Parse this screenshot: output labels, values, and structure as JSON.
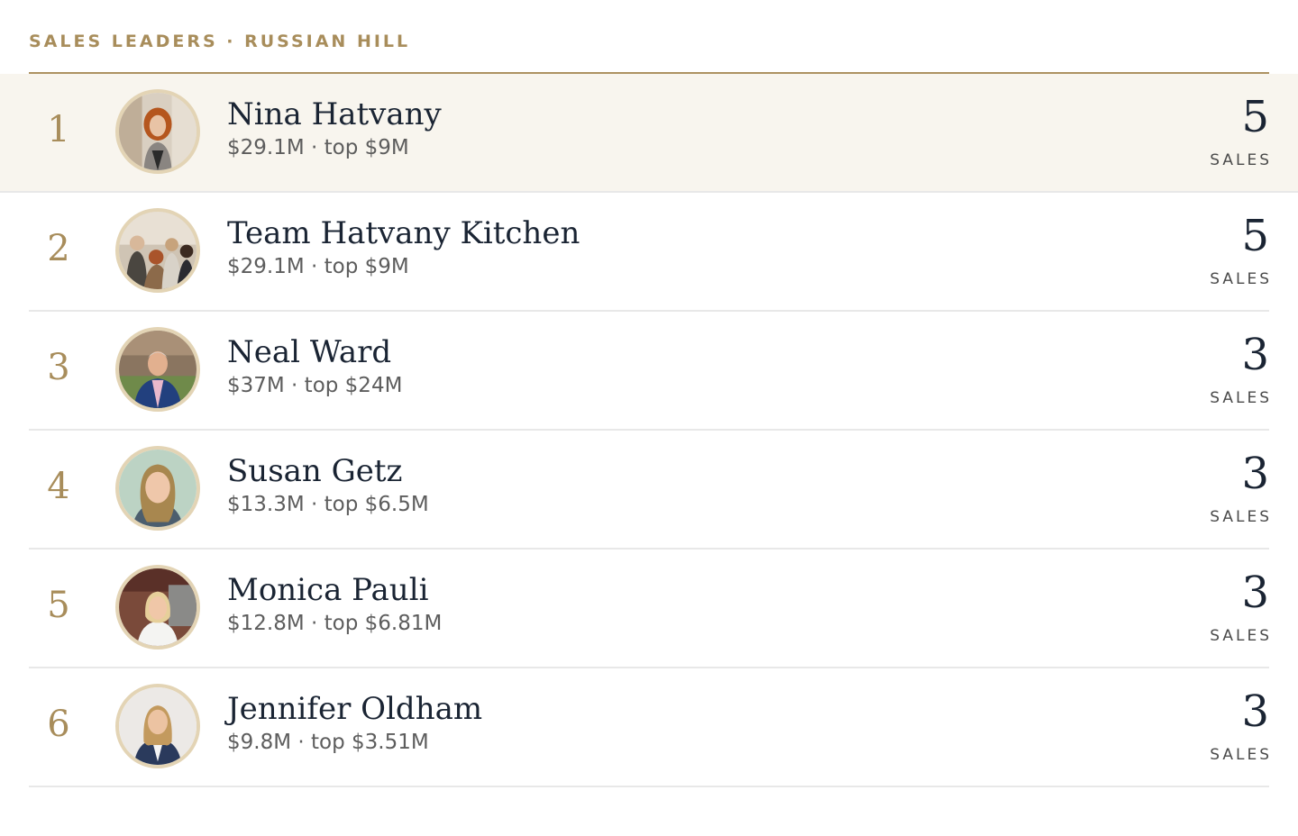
{
  "header": {
    "title": "SALES LEADERS · RUSSIAN HILL"
  },
  "leaders": [
    {
      "rank": "1",
      "name": "Nina Hatvany",
      "stats": "$29.1M · top $9M",
      "sales": "5",
      "sales_label": "SALES",
      "avatar": "portrait-woman-curly-red-hair"
    },
    {
      "rank": "2",
      "name": "Team Hatvany Kitchen",
      "stats": "$29.1M · top $9M",
      "sales": "5",
      "sales_label": "SALES",
      "avatar": "group-photo-team"
    },
    {
      "rank": "3",
      "name": "Neal Ward",
      "stats": "$37M · top $24M",
      "sales": "3",
      "sales_label": "SALES",
      "avatar": "portrait-man-blue-suit"
    },
    {
      "rank": "4",
      "name": "Susan Getz",
      "stats": "$13.3M · top $6.5M",
      "sales": "3",
      "sales_label": "SALES",
      "avatar": "portrait-woman-blonde"
    },
    {
      "rank": "5",
      "name": "Monica Pauli",
      "stats": "$12.8M · top $6.81M",
      "sales": "3",
      "sales_label": "SALES",
      "avatar": "portrait-woman-white-blouse"
    },
    {
      "rank": "6",
      "name": "Jennifer Oldham",
      "stats": "$9.8M · top $3.51M",
      "sales": "3",
      "sales_label": "SALES",
      "avatar": "portrait-woman-navy-blazer"
    }
  ],
  "colors": {
    "accent": "#a88d5b",
    "highlight_row": "#f8f5ee",
    "text_dark": "#1a2433",
    "text_muted": "#5d5d5d"
  }
}
